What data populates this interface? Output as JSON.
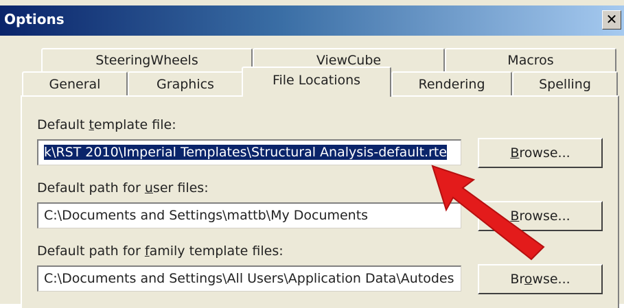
{
  "window": {
    "title": "Options",
    "close": "✕"
  },
  "tabs_row1": [
    {
      "label": "SteeringWheels"
    },
    {
      "label": "ViewCube"
    },
    {
      "label": "Macros"
    }
  ],
  "tabs_row2": [
    {
      "label": "General"
    },
    {
      "label": "Graphics"
    },
    {
      "label": "File Locations",
      "active": true
    },
    {
      "label": "Rendering"
    },
    {
      "label": "Spelling"
    }
  ],
  "fields": [
    {
      "label_pre": "Default ",
      "label_u": "t",
      "label_post": "emplate file:",
      "value": "k\\RST 2010\\Imperial Templates\\Structural Analysis-default.rte",
      "selected": true,
      "button_pre": "",
      "button_u": "B",
      "button_post": "rowse..."
    },
    {
      "label_pre": "Default path for ",
      "label_u": "u",
      "label_post": "ser files:",
      "value": "C:\\Documents and Settings\\mattb\\My Documents",
      "button_pre": "",
      "button_u": "B",
      "button_post": "rowse..."
    },
    {
      "label_pre": "Default path for ",
      "label_u": "f",
      "label_post": "amily template files:",
      "value": "C:\\Documents and Settings\\All Users\\Application Data\\Autodes",
      "button_pre": "Br",
      "button_u": "o",
      "button_post": "wse..."
    }
  ],
  "annotation": {
    "color": "#e31b1b"
  }
}
